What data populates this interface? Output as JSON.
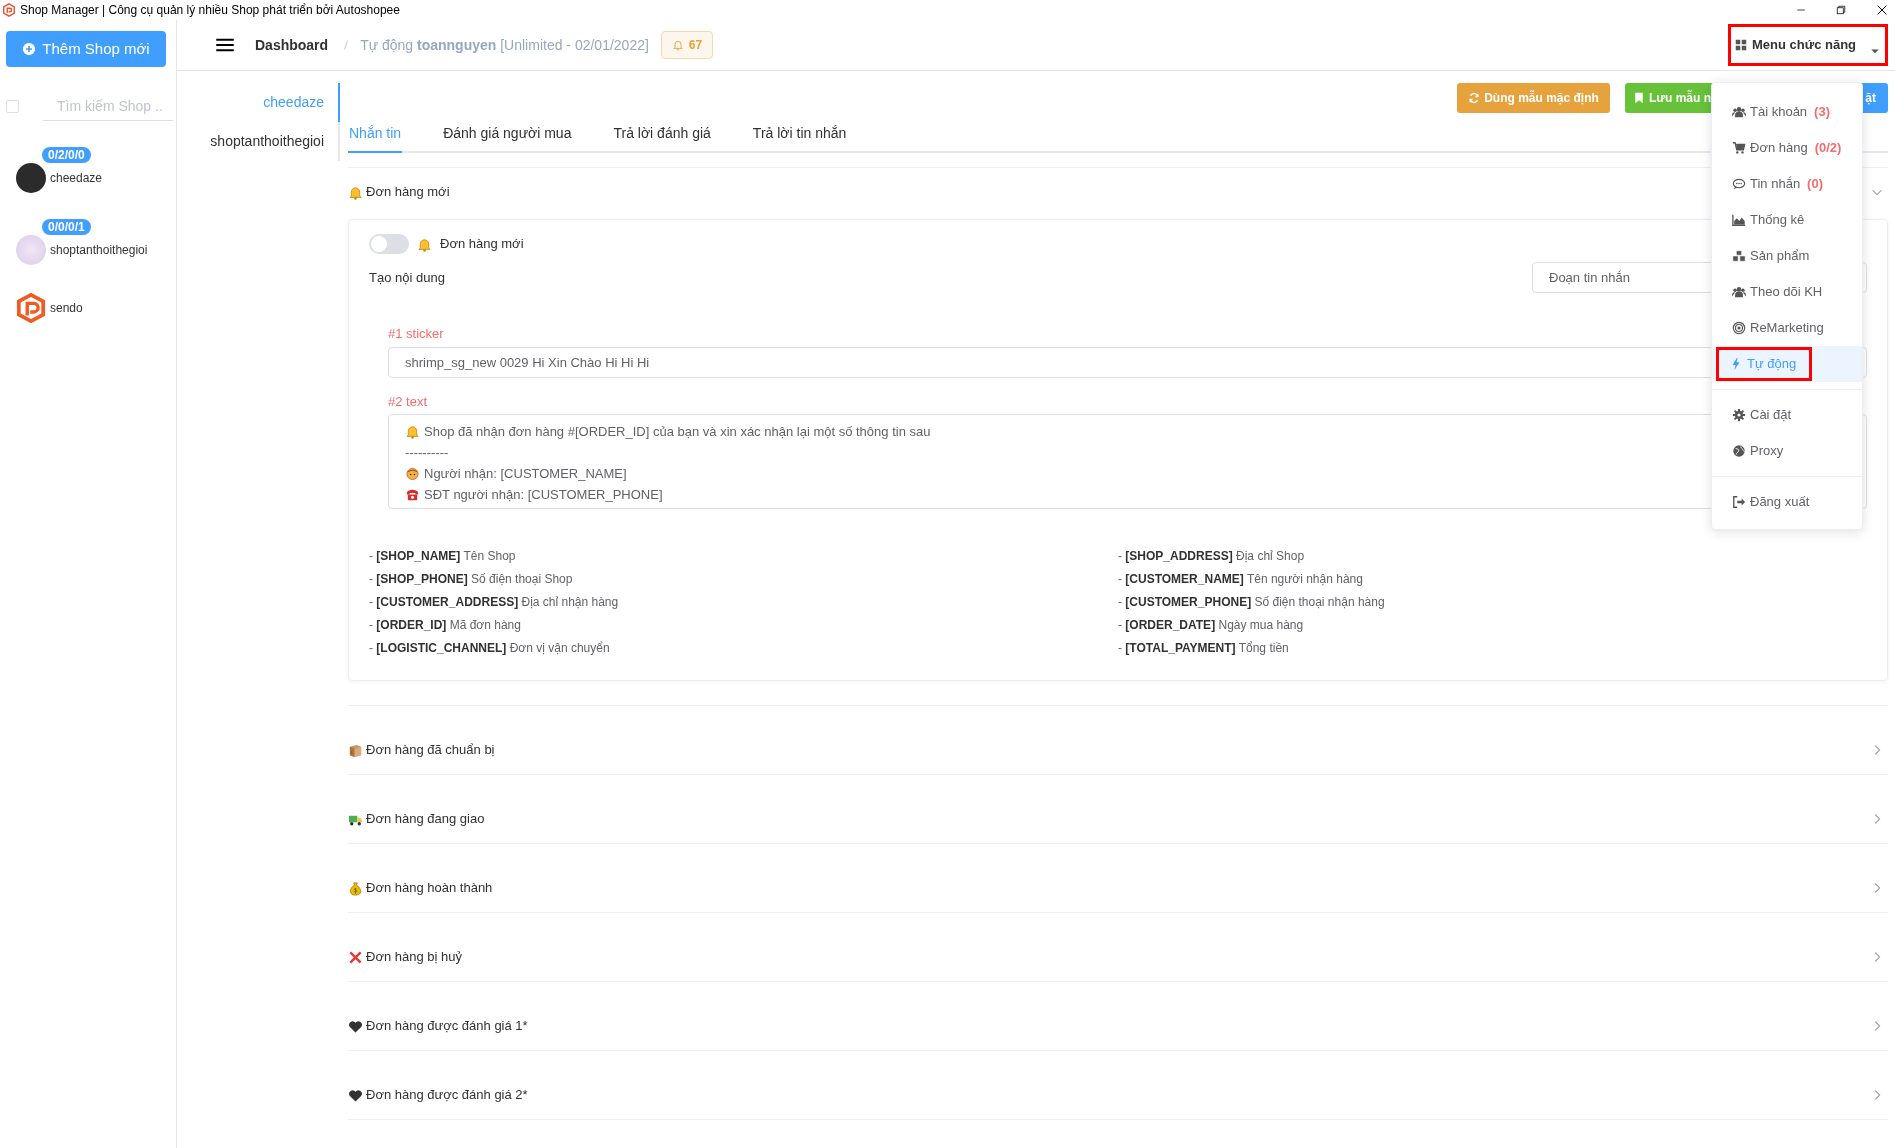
{
  "window": {
    "title": "Shop Manager | Công cụ quản lý nhiều Shop phát triển bởi Autoshopee"
  },
  "sidebar": {
    "add_button": "Thêm Shop mới",
    "select_all": {
      "checked": false
    },
    "search": {
      "placeholder": "Tìm kiếm Shop .."
    },
    "shops": [
      {
        "kind": "avatar",
        "counts": "0/2/0/0",
        "name": "cheedaze"
      },
      {
        "kind": "avatar",
        "counts": "0/0/0/1",
        "name": "shoptanthoithegioi"
      },
      {
        "kind": "logo",
        "name": "sendo"
      }
    ]
  },
  "header": {
    "breadcrumb": [
      "Dashboard",
      "Tự động **toannguyen** [Unlimited - 02/01/2022]"
    ],
    "notifications": "67",
    "menu_button": {
      "label": "Menu chức năng",
      "highlighted": true
    }
  },
  "menu": {
    "groups": [
      [
        {
          "kind": "users",
          "label": "Tài khoản",
          "count": "(3)",
          "selected": false,
          "highlighted": false
        },
        {
          "kind": "cart",
          "label": "Đơn hàng",
          "count": "(0/2)",
          "selected": false,
          "highlighted": false
        },
        {
          "kind": "comment",
          "label": "Tin nhắn",
          "count": "(0)",
          "selected": false,
          "highlighted": false
        },
        {
          "kind": "chart",
          "label": "Thống kê",
          "selected": false,
          "highlighted": false
        },
        {
          "kind": "cubes",
          "label": "Sản phẩm",
          "selected": false,
          "highlighted": false
        },
        {
          "kind": "users",
          "label": "Theo dõi KH",
          "selected": false,
          "highlighted": false
        },
        {
          "kind": "target",
          "label": "ReMarketing",
          "selected": false,
          "highlighted": false
        },
        {
          "kind": "bolt",
          "label": "Tự động",
          "selected": true,
          "highlighted": true
        }
      ],
      [
        {
          "kind": "gear",
          "label": "Cài đặt",
          "selected": false,
          "highlighted": false
        },
        {
          "kind": "globe",
          "label": "Proxy",
          "selected": false,
          "highlighted": false
        }
      ],
      [
        {
          "kind": "logout",
          "label": "Đăng xuất",
          "selected": false,
          "highlighted": false
        }
      ]
    ]
  },
  "shop_tabs": [
    {
      "label": "cheedaze",
      "selected": true
    },
    {
      "label": "shoptanthoithegioi",
      "selected": false
    }
  ],
  "actions": [
    {
      "kind": "default",
      "label": "Dùng mẫu mặc định"
    },
    {
      "kind": "save",
      "label": "Lưu mẫu n"
    },
    {
      "kind": "apply",
      "label": "ặt"
    }
  ],
  "tabs": [
    {
      "label": "Nhắn tin",
      "selected": true
    },
    {
      "label": "Đánh giá người mua",
      "selected": false
    },
    {
      "label": "Trả lời đánh giá",
      "selected": false
    },
    {
      "label": "Trả lời tin nhắn",
      "selected": false
    }
  ],
  "sections": [
    {
      "kind": "bell",
      "title": "Đơn hàng mới",
      "expanded": true,
      "body": {
        "toggle": {
          "on": false,
          "label": "Đơn hàng mới"
        },
        "content_label": "Tạo nội dung",
        "snippet": {
          "placeholder": "Đoạn tin nhắn"
        },
        "parts": [
          {
            "kind": "input",
            "label": "#1 sticker",
            "value": "shrimp_sg_new 0029 Hi Xin Chào Hi Hi Hi"
          },
          {
            "kind": "textarea",
            "label": "#2 text",
            "lines": [
              {
                "kind": "bell",
                "text": "Shop đã nhận đơn hàng #[ORDER_ID] của bạn và xin xác nhận lại một số thông tin sau"
              },
              {
                "text": "----------"
              },
              {
                "kind": "person",
                "text": "Người nhận: [CUSTOMER_NAME]"
              },
              {
                "kind": "phone",
                "text": "SĐT người nhận: [CUSTOMER_PHONE]"
              }
            ]
          }
        ],
        "variables": [
          [
            "- **[SHOP_NAME]** Tên Shop",
            "- **[SHOP_PHONE]** Số điện thoại Shop",
            "- **[CUSTOMER_ADDRESS]** Địa chỉ nhận hàng",
            "- **[ORDER_ID]** Mã đơn hàng",
            "- **[LOGISTIC_CHANNEL]** Đơn vị vận chuyển"
          ],
          [
            "- **[SHOP_ADDRESS]** Địa chỉ Shop",
            "- **[CUSTOMER_NAME]** Tên người nhận hàng",
            "- **[CUSTOMER_PHONE]** Số điện thoại nhận hàng",
            "- **[ORDER_DATE]** Ngày mua hàng",
            "- **[TOTAL_PAYMENT]** Tổng tiền"
          ]
        ]
      }
    },
    {
      "kind": "package",
      "title": "Đơn hàng đã chuẩn bị",
      "expanded": false
    },
    {
      "kind": "truck",
      "title": "Đơn hàng đang giao",
      "expanded": false
    },
    {
      "kind": "moneybag",
      "title": "Đơn hàng hoàn thành",
      "expanded": false
    },
    {
      "kind": "cross",
      "title": "Đơn hàng bị huỷ",
      "expanded": false
    },
    {
      "kind": "heart",
      "title": "Đơn hàng được đánh giá 1*",
      "expanded": false
    },
    {
      "kind": "heart",
      "title": "Đơn hàng được đánh giá 2*",
      "expanded": false
    }
  ]
}
